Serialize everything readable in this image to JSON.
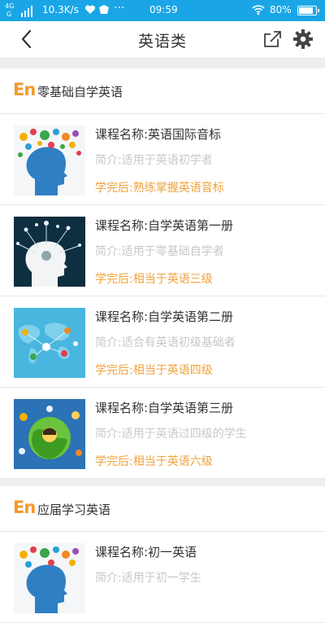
{
  "status_bar": {
    "network_top": "4G",
    "network_bottom": "G",
    "speed": "10.3K/s",
    "time": "09:59",
    "battery": "80%"
  },
  "nav": {
    "title": "英语类",
    "back_icon": "chevron-left-icon",
    "share_icon": "share-icon",
    "settings_icon": "gear-icon"
  },
  "sections": [
    {
      "badge": "En",
      "title": "零基础自学英语",
      "courses": [
        {
          "name": "课程名称:英语国际音标",
          "intro": "简介:适用于英语初学者",
          "after": "学完后:熟练掌握英语音标",
          "thumb": "head-silhouette-icons"
        },
        {
          "name": "课程名称:自学英语第一册",
          "intro": "简介:适用于零基础自学者",
          "after": "学完后:相当于英语三级",
          "thumb": "head-circuit-lightbulb"
        },
        {
          "name": "课程名称:自学英语第二册",
          "intro": "简介:适合有英语初级基础者",
          "after": "学完后:相当于英语四级",
          "thumb": "world-map-people"
        },
        {
          "name": "课程名称:自学英语第三册",
          "intro": "简介:适用于英语过四级的学生",
          "after": "学完后:相当于英语六级",
          "thumb": "globe-people"
        }
      ]
    },
    {
      "badge": "En",
      "title": "应届学习英语",
      "courses": [
        {
          "name": "课程名称:初一英语",
          "intro": "简介:适用于初一学生",
          "after": "",
          "thumb": "head-silhouette-icons"
        }
      ]
    }
  ],
  "colors": {
    "status_bar": "#1aa6e6",
    "accent_orange": "#f39a2c",
    "intro_gray": "#c8c8c8"
  }
}
